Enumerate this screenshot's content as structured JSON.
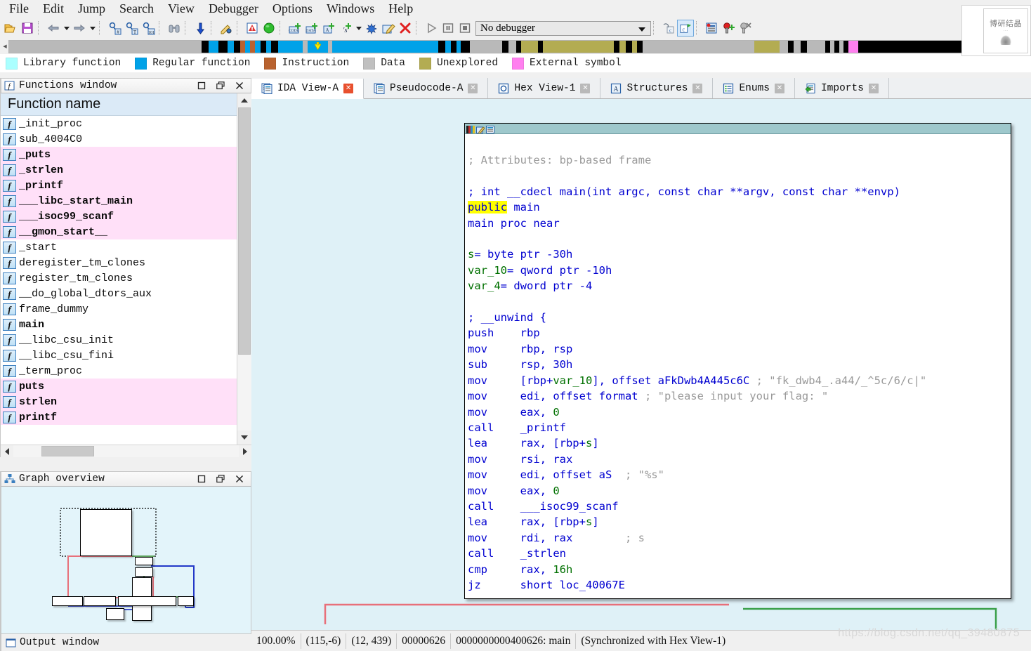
{
  "menubar": {
    "items": [
      "File",
      "Edit",
      "Jump",
      "Search",
      "View",
      "Debugger",
      "Options",
      "Windows",
      "Help"
    ]
  },
  "toolbar": {
    "debugger_select_value": "No debugger",
    "buttons": [
      {
        "name": "open-file-icon",
        "label": "Open"
      },
      {
        "name": "save-file-icon",
        "label": "Save"
      },
      {
        "name": "back-nav-icon",
        "label": "Back"
      },
      {
        "name": "back-nav-dropdown-icon",
        "label": "Back history"
      },
      {
        "name": "forward-nav-icon",
        "label": "Forward"
      },
      {
        "name": "forward-nav-dropdown-icon",
        "label": "Forward history"
      },
      {
        "name": "search-hash-icon",
        "label": "Search hex"
      },
      {
        "name": "search-text-icon",
        "label": "Search text"
      },
      {
        "name": "search-binary-icon",
        "label": "Search sequence"
      },
      {
        "name": "binoculars-icon",
        "label": "Find"
      },
      {
        "name": "jump-down-arrow-icon",
        "label": "Jump to address"
      },
      {
        "name": "key-edit-icon",
        "label": "Edit function"
      },
      {
        "name": "warning-triangle-icon",
        "label": "Problems"
      },
      {
        "name": "green-circle-icon",
        "label": "Run"
      },
      {
        "name": "make-code-icon",
        "label": "Make code"
      },
      {
        "name": "make-data-icon",
        "label": "Make data"
      },
      {
        "name": "make-array-icon",
        "label": "Make array"
      },
      {
        "name": "make-string-icon",
        "label": "Make string"
      },
      {
        "name": "make-string-dropdown-icon",
        "label": "String type"
      },
      {
        "name": "undefine-icon",
        "label": "Undefine"
      },
      {
        "name": "rename-icon",
        "label": "Rename"
      },
      {
        "name": "delete-red-x-icon",
        "label": "Delete"
      },
      {
        "name": "debug-run-icon",
        "label": "Start process"
      },
      {
        "name": "debug-pause-icon",
        "label": "Pause process"
      },
      {
        "name": "debug-stop-icon",
        "label": "Terminate process"
      },
      {
        "name": "step-over-source-icon",
        "label": "Step over source"
      },
      {
        "name": "step-into-source-icon",
        "label": "Step into source"
      },
      {
        "name": "breakpoint-list-icon",
        "label": "Breakpoint list"
      },
      {
        "name": "add-breakpoint-icon",
        "label": "Add breakpoint"
      },
      {
        "name": "delete-breakpoint-icon",
        "label": "Delete breakpoint"
      }
    ]
  },
  "navband": {
    "segments": [
      {
        "color": "#b9b9b9",
        "width": 19.0
      },
      {
        "color": "#000000",
        "width": 0.7
      },
      {
        "color": "#00a2e8",
        "width": 1.0
      },
      {
        "color": "#000000",
        "width": 0.9
      },
      {
        "color": "#00a2e8",
        "width": 0.6
      },
      {
        "color": "#000000",
        "width": 0.6
      },
      {
        "color": "#b9622f",
        "width": 0.5
      },
      {
        "color": "#00a2e8",
        "width": 0.5
      },
      {
        "color": "#b9622f",
        "width": 0.5
      },
      {
        "color": "#00a2e8",
        "width": 0.5
      },
      {
        "color": "#000000",
        "width": 0.6
      },
      {
        "color": "#00a2e8",
        "width": 0.5
      },
      {
        "color": "#000000",
        "width": 0.7
      },
      {
        "color": "#00a2e8",
        "width": 2.4
      },
      {
        "color": "#b9b9b9",
        "width": 0.5
      },
      {
        "color": "#00a2e8",
        "width": 2.0
      },
      {
        "color": "#b9b9b9",
        "width": 0.4
      },
      {
        "color": "#00a2e8",
        "width": 10.5
      },
      {
        "color": "#000000",
        "width": 0.7
      },
      {
        "color": "#00a2e8",
        "width": 0.5
      },
      {
        "color": "#000000",
        "width": 0.6
      },
      {
        "color": "#00a2e8",
        "width": 0.4
      },
      {
        "color": "#000000",
        "width": 0.9
      },
      {
        "color": "#b9b9b9",
        "width": 3.2
      },
      {
        "color": "#000000",
        "width": 0.6
      },
      {
        "color": "#b9b9b9",
        "width": 0.8
      },
      {
        "color": "#000000",
        "width": 0.5
      },
      {
        "color": "#b3ac52",
        "width": 1.6
      },
      {
        "color": "#000000",
        "width": 0.5
      },
      {
        "color": "#b3ac52",
        "width": 7.0
      },
      {
        "color": "#000000",
        "width": 0.6
      },
      {
        "color": "#b3ac52",
        "width": 0.6
      },
      {
        "color": "#000000",
        "width": 0.6
      },
      {
        "color": "#b3ac52",
        "width": 0.5
      },
      {
        "color": "#000000",
        "width": 0.6
      },
      {
        "color": "#b9b9b9",
        "width": 11.0
      },
      {
        "color": "#b3ac52",
        "width": 2.5
      },
      {
        "color": "#b9b9b9",
        "width": 0.8
      },
      {
        "color": "#000000",
        "width": 0.6
      },
      {
        "color": "#b9b9b9",
        "width": 0.7
      },
      {
        "color": "#000000",
        "width": 0.6
      },
      {
        "color": "#b9b9b9",
        "width": 1.8
      },
      {
        "color": "#000000",
        "width": 0.5
      },
      {
        "color": "#b9b9b9",
        "width": 0.4
      },
      {
        "color": "#000000",
        "width": 0.5
      },
      {
        "color": "#b9b9b9",
        "width": 0.4
      },
      {
        "color": "#000000",
        "width": 0.5
      },
      {
        "color": "#ff7fef",
        "width": 1.0
      },
      {
        "color": "#000000",
        "width": 13.0
      }
    ],
    "cursor_position_pct": 30.2,
    "cursor_color": "#ffee00"
  },
  "legend": {
    "items": [
      {
        "label": "Library function",
        "color": "#aaffff"
      },
      {
        "label": "Regular function",
        "color": "#00a2e8"
      },
      {
        "label": "Instruction",
        "color": "#b9622f"
      },
      {
        "label": "Data",
        "color": "#c0c0c0"
      },
      {
        "label": "Unexplored",
        "color": "#b3ac52"
      },
      {
        "label": "External symbol",
        "color": "#ff7fef"
      }
    ]
  },
  "functions_window": {
    "title": "Functions window",
    "column_header": "Function name",
    "rows": [
      {
        "name": "_init_proc",
        "library": false
      },
      {
        "name": "sub_4004C0",
        "library": false
      },
      {
        "name": "_puts",
        "library": true
      },
      {
        "name": "_strlen",
        "library": true
      },
      {
        "name": "_printf",
        "library": true
      },
      {
        "name": "___libc_start_main",
        "library": true
      },
      {
        "name": "___isoc99_scanf",
        "library": true
      },
      {
        "name": "__gmon_start__",
        "library": true
      },
      {
        "name": "_start",
        "library": false
      },
      {
        "name": "deregister_tm_clones",
        "library": false
      },
      {
        "name": "register_tm_clones",
        "library": false
      },
      {
        "name": "__do_global_dtors_aux",
        "library": false
      },
      {
        "name": "frame_dummy",
        "library": false
      },
      {
        "name": "main",
        "library": false,
        "bold": true
      },
      {
        "name": "__libc_csu_init",
        "library": false
      },
      {
        "name": "__libc_csu_fini",
        "library": false
      },
      {
        "name": "_term_proc",
        "library": false
      },
      {
        "name": "puts",
        "library": true
      },
      {
        "name": "strlen",
        "library": true
      },
      {
        "name": "printf",
        "library": true
      }
    ],
    "window_buttons": [
      "maximize-icon",
      "restore-icon",
      "close-icon"
    ]
  },
  "graph_overview": {
    "title": "Graph overview",
    "window_buttons": [
      "maximize-icon",
      "restore-icon",
      "close-icon"
    ]
  },
  "output_window": {
    "title": "Output window"
  },
  "tabs": [
    {
      "label": "IDA View-A",
      "icon": "ida-view-icon",
      "active": true
    },
    {
      "label": "Pseudocode-A",
      "icon": "pseudocode-icon",
      "active": false
    },
    {
      "label": "Hex View-1",
      "icon": "hex-view-icon",
      "active": false
    },
    {
      "label": "Structures",
      "icon": "structures-icon",
      "active": false
    },
    {
      "label": "Enums",
      "icon": "enums-icon",
      "active": false
    },
    {
      "label": "Imports",
      "icon": "imports-icon",
      "active": false
    }
  ],
  "disassembly": {
    "node_toolbar_icons": [
      "color-palette-icon",
      "edit-node-icon",
      "graph-node-icon"
    ],
    "lines": [
      {
        "segments": [
          {
            "t": "; Attributes: bp-based frame",
            "c": "cmt"
          }
        ]
      },
      {
        "segments": [
          {
            "t": "",
            "c": "black"
          }
        ]
      },
      {
        "segments": [
          {
            "t": "; int __cdecl main(int argc, const char **argv, const char **envp)",
            "c": "blue"
          }
        ]
      },
      {
        "segments": [
          {
            "t": "public",
            "c": "hl"
          },
          {
            "t": " main",
            "c": "blue"
          }
        ]
      },
      {
        "segments": [
          {
            "t": "main proc near",
            "c": "blue"
          }
        ]
      },
      {
        "segments": [
          {
            "t": "",
            "c": "black"
          }
        ]
      },
      {
        "segments": [
          {
            "t": "s",
            "c": "green"
          },
          {
            "t": "= byte ptr -30h",
            "c": "blue"
          }
        ]
      },
      {
        "segments": [
          {
            "t": "var_10",
            "c": "green"
          },
          {
            "t": "= qword ptr -10h",
            "c": "blue"
          }
        ]
      },
      {
        "segments": [
          {
            "t": "var_4",
            "c": "green"
          },
          {
            "t": "= dword ptr -4",
            "c": "blue"
          }
        ]
      },
      {
        "segments": [
          {
            "t": "",
            "c": "black"
          }
        ]
      },
      {
        "segments": [
          {
            "t": "; __unwind {",
            "c": "blue"
          }
        ]
      },
      {
        "segments": [
          {
            "t": "push    rbp",
            "c": "blue"
          }
        ]
      },
      {
        "segments": [
          {
            "t": "mov     rbp, rsp",
            "c": "blue"
          }
        ]
      },
      {
        "segments": [
          {
            "t": "sub     rsp, 30h",
            "c": "blue"
          }
        ]
      },
      {
        "segments": [
          {
            "t": "mov     [rbp+",
            "c": "blue"
          },
          {
            "t": "var_10",
            "c": "green"
          },
          {
            "t": "], offset aFkDwb4A445c6C ",
            "c": "blue"
          },
          {
            "t": "; \"fk_dwb4_.a44/_^5c/6/c|\"",
            "c": "cmt"
          }
        ]
      },
      {
        "segments": [
          {
            "t": "mov     edi, offset format ",
            "c": "blue"
          },
          {
            "t": "; \"please input your flag: \"",
            "c": "cmt"
          }
        ]
      },
      {
        "segments": [
          {
            "t": "mov     eax, ",
            "c": "blue"
          },
          {
            "t": "0",
            "c": "green"
          }
        ]
      },
      {
        "segments": [
          {
            "t": "call    _printf",
            "c": "blue"
          }
        ]
      },
      {
        "segments": [
          {
            "t": "lea     rax, [rbp+",
            "c": "blue"
          },
          {
            "t": "s",
            "c": "green"
          },
          {
            "t": "]",
            "c": "blue"
          }
        ]
      },
      {
        "segments": [
          {
            "t": "mov     rsi, rax",
            "c": "blue"
          }
        ]
      },
      {
        "segments": [
          {
            "t": "mov     edi, offset aS  ",
            "c": "blue"
          },
          {
            "t": "; \"%s\"",
            "c": "cmt"
          }
        ]
      },
      {
        "segments": [
          {
            "t": "mov     eax, ",
            "c": "blue"
          },
          {
            "t": "0",
            "c": "green"
          }
        ]
      },
      {
        "segments": [
          {
            "t": "call    ___isoc99_scanf",
            "c": "blue"
          }
        ]
      },
      {
        "segments": [
          {
            "t": "lea     rax, [rbp+",
            "c": "blue"
          },
          {
            "t": "s",
            "c": "green"
          },
          {
            "t": "]",
            "c": "blue"
          }
        ]
      },
      {
        "segments": [
          {
            "t": "mov     rdi, rax        ",
            "c": "blue"
          },
          {
            "t": "; s",
            "c": "cmt"
          }
        ]
      },
      {
        "segments": [
          {
            "t": "call    _strlen",
            "c": "blue"
          }
        ]
      },
      {
        "segments": [
          {
            "t": "cmp     rax, ",
            "c": "blue"
          },
          {
            "t": "16h",
            "c": "green"
          }
        ]
      },
      {
        "segments": [
          {
            "t": "jz      short loc_40067E",
            "c": "blue"
          }
        ]
      }
    ]
  },
  "statusbar": {
    "zoom": "100.00%",
    "graph_coords": "(115,-6)",
    "screen_coords": "(12, 439)",
    "file_offset": "00000626",
    "address": "0000000000400626: main",
    "sync": "(Synchronized with Hex View-1)"
  },
  "watermarks": {
    "bottom_right_url": "https://blog.csdn.net/qq_39480875",
    "top_right_caption": "博研结晶"
  }
}
